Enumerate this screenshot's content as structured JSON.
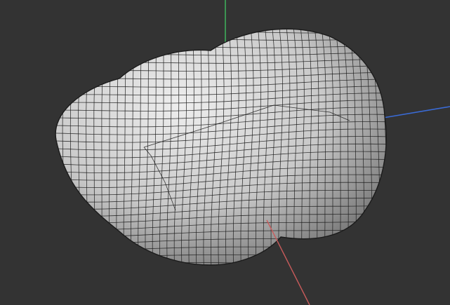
{
  "viewport": {
    "background_color": "#333333",
    "mesh_fill_color": "#c9c9c9",
    "mesh_shadow_color": "#6e6e6e",
    "mesh_highlight_color": "#eeeeee",
    "wireframe_color": "#1b1b1b",
    "axes": {
      "x_color": "#c95b5b",
      "y_color": "#3fae5a",
      "z_color": "#3a6bd6"
    }
  }
}
